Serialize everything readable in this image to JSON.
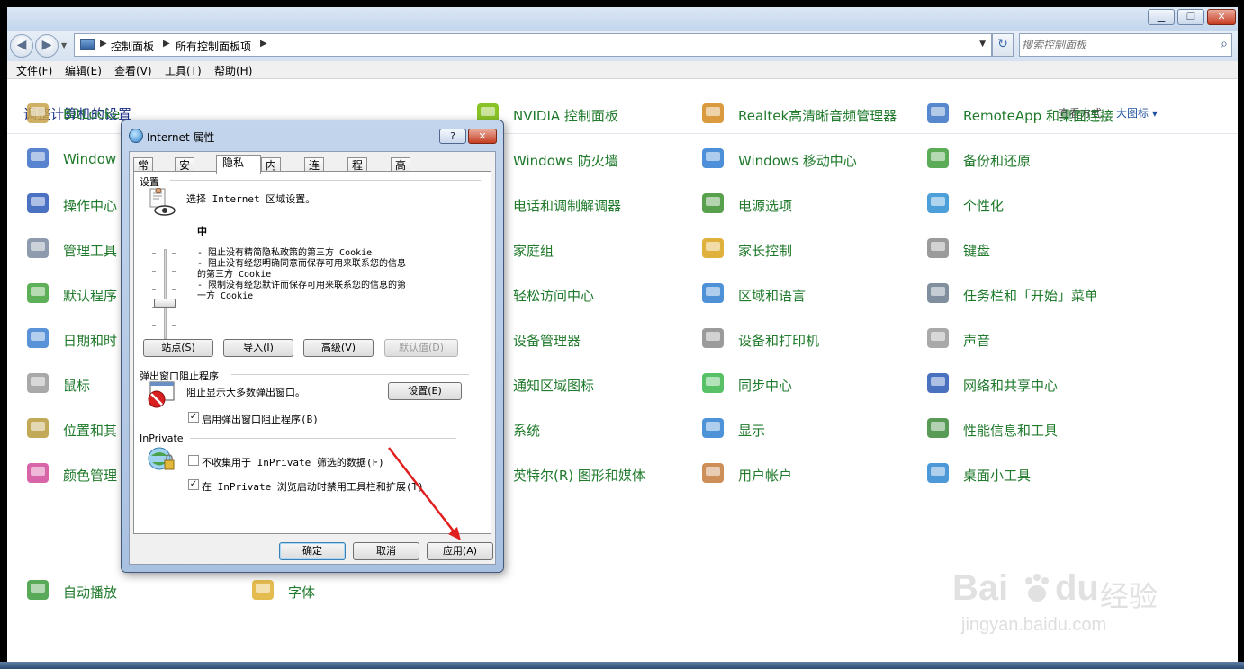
{
  "window": {
    "min_label": "▁",
    "max_label": "❐",
    "close_label": "✕"
  },
  "nav": {
    "back_glyph": "◀",
    "forward_glyph": "▶",
    "breadcrumb": [
      "控制面板",
      "所有控制面板项"
    ],
    "breadcrumb_sep": "▶",
    "dropdown_glyph": "▼",
    "refresh_glyph": "↻",
    "search_placeholder": "搜索控制面板",
    "search_glyph": "⌕"
  },
  "menu": [
    "文件(F)",
    "编辑(E)",
    "查看(V)",
    "工具(T)",
    "帮助(H)"
  ],
  "content": {
    "heading": "调整计算机的设置",
    "view_by_label": "查看方式:",
    "view_by_value": "大图标 ▾"
  },
  "items": [
    {
      "label": "BitLocke",
      "icon": "bitlocker-icon",
      "color": "#c8a24a"
    },
    {
      "label": "NVIDIA 控制面板",
      "icon": "nvidia-icon",
      "color": "#76b900"
    },
    {
      "label": "Realtek高清晰音频管理器",
      "icon": "realtek-audio-icon",
      "color": "#d38a1f"
    },
    {
      "label": "RemoteApp 和桌面连接",
      "icon": "remoteapp-icon",
      "color": "#3a73c4"
    },
    {
      "label": "Window",
      "icon": "windows-update-icon",
      "color": "#3b6fc7"
    },
    {
      "label": "Windows 防火墙",
      "icon": "firewall-icon",
      "color": "#b3412b"
    },
    {
      "label": "Windows 移动中心",
      "icon": "mobility-center-icon",
      "color": "#2e7bd1"
    },
    {
      "label": "备份和还原",
      "icon": "backup-icon",
      "color": "#3f9c3a"
    },
    {
      "label": "操作中心",
      "icon": "action-center-flag-icon",
      "color": "#2c58b8"
    },
    {
      "label": "电话和调制解调器",
      "icon": "phone-modem-icon",
      "color": "#666666"
    },
    {
      "label": "电源选项",
      "icon": "power-options-icon",
      "color": "#3c8f2f"
    },
    {
      "label": "个性化",
      "icon": "personalization-icon",
      "color": "#2e8ed2"
    },
    {
      "label": "管理工具",
      "icon": "admin-tools-icon",
      "color": "#7a8aa0"
    },
    {
      "label": "家庭组",
      "icon": "homegroup-icon",
      "color": "#2d9bd6"
    },
    {
      "label": "家长控制",
      "icon": "parental-controls-icon",
      "color": "#d9a21a"
    },
    {
      "label": "键盘",
      "icon": "keyboard-icon",
      "color": "#8a8a8a"
    },
    {
      "label": "默认程序",
      "icon": "default-programs-icon",
      "color": "#41a23a"
    },
    {
      "label": "轻松访问中心",
      "icon": "ease-of-access-icon",
      "color": "#2d6fc2"
    },
    {
      "label": "区域和语言",
      "icon": "region-language-icon",
      "color": "#2f7ed0"
    },
    {
      "label": "任务栏和「开始」菜单",
      "icon": "taskbar-icon",
      "color": "#6b7a8c"
    },
    {
      "label": "日期和时",
      "icon": "date-time-icon",
      "color": "#3c7fd0"
    },
    {
      "label": "设备管理器",
      "icon": "device-manager-icon",
      "color": "#6c7f98"
    },
    {
      "label": "设备和打印机",
      "icon": "printer-icon",
      "color": "#8a8a8a"
    },
    {
      "label": "声音",
      "icon": "sound-icon",
      "color": "#9a9a9a"
    },
    {
      "label": "鼠标",
      "icon": "mouse-icon",
      "color": "#9a9a9a"
    },
    {
      "label": "通知区域图标",
      "icon": "notification-icons-icon",
      "color": "#5a6a7a"
    },
    {
      "label": "同步中心",
      "icon": "sync-center-icon",
      "color": "#3bb54a"
    },
    {
      "label": "网络和共享中心",
      "icon": "network-sharing-icon",
      "color": "#2a58b5"
    },
    {
      "label": "位置和其",
      "icon": "location-sensors-icon",
      "color": "#b79a3a"
    },
    {
      "label": "系统",
      "icon": "system-icon",
      "color": "#2f6fb8"
    },
    {
      "label": "显示",
      "icon": "display-icon",
      "color": "#2f80d0"
    },
    {
      "label": "性能信息和工具",
      "icon": "performance-icon",
      "color": "#3a8a3a"
    },
    {
      "label": "颜色管理",
      "icon": "color-management-icon",
      "color": "#d24a9a"
    },
    {
      "label": "英特尔(R) 图形和媒体",
      "icon": "intel-graphics-icon",
      "color": "#4a6fb5"
    },
    {
      "label": "用户帐户",
      "icon": "user-accounts-icon",
      "color": "#c47a3a"
    },
    {
      "label": "桌面小工具",
      "icon": "gadgets-icon",
      "color": "#2e86d0"
    },
    {
      "label": "自动播放",
      "icon": "autoplay-icon",
      "color": "#3b9a3b"
    },
    {
      "label": "字体",
      "icon": "fonts-icon",
      "color": "#e0b030"
    }
  ],
  "dialog": {
    "title": "Internet 属性",
    "help_label": "?",
    "close_label": "✕",
    "tabs": [
      "常规",
      "安全",
      "隐私",
      "内容",
      "连接",
      "程序",
      "高级"
    ],
    "active_tab": "隐私",
    "settings_group": "设置",
    "zone_text": "选择 Internet 区域设置。",
    "level": "中",
    "desc_lines": [
      "- 阻止没有精简隐私政策的第三方 Cookie",
      "- 阻止没有经您明确同意而保存可用来联系您的信息",
      "的第三方 Cookie",
      "- 限制没有经您默许而保存可用来联系您的信息的第",
      "一方 Cookie"
    ],
    "buttons_row": [
      "站点(S)",
      "导入(I)",
      "高级(V)",
      "默认值(D)"
    ],
    "popup_group": "弹出窗口阻止程序",
    "popup_text": "阻止显示大多数弹出窗口。",
    "popup_settings": "设置(E)",
    "popup_checkbox": "启用弹出窗口阻止程序(B)",
    "popup_checked": true,
    "inprivate_group": "InPrivate",
    "inprivate_cb1": "不收集用于 InPrivate 筛选的数据(F)",
    "inprivate_cb1_checked": false,
    "inprivate_cb2": "在 InPrivate 浏览启动时禁用工具栏和扩展(T)",
    "inprivate_cb2_checked": true,
    "ok": "确定",
    "cancel": "取消",
    "apply": "应用(A)",
    "check_glyph": "✓"
  },
  "watermark": {
    "brand": "Bai",
    "brand2": "du",
    "brand_cn": "经验",
    "url": "jingyan.baidu.com"
  },
  "colors": {
    "link_green": "#1f7a2b",
    "heading_blue": "#1e3287",
    "arrow_red": "#e0201e"
  }
}
